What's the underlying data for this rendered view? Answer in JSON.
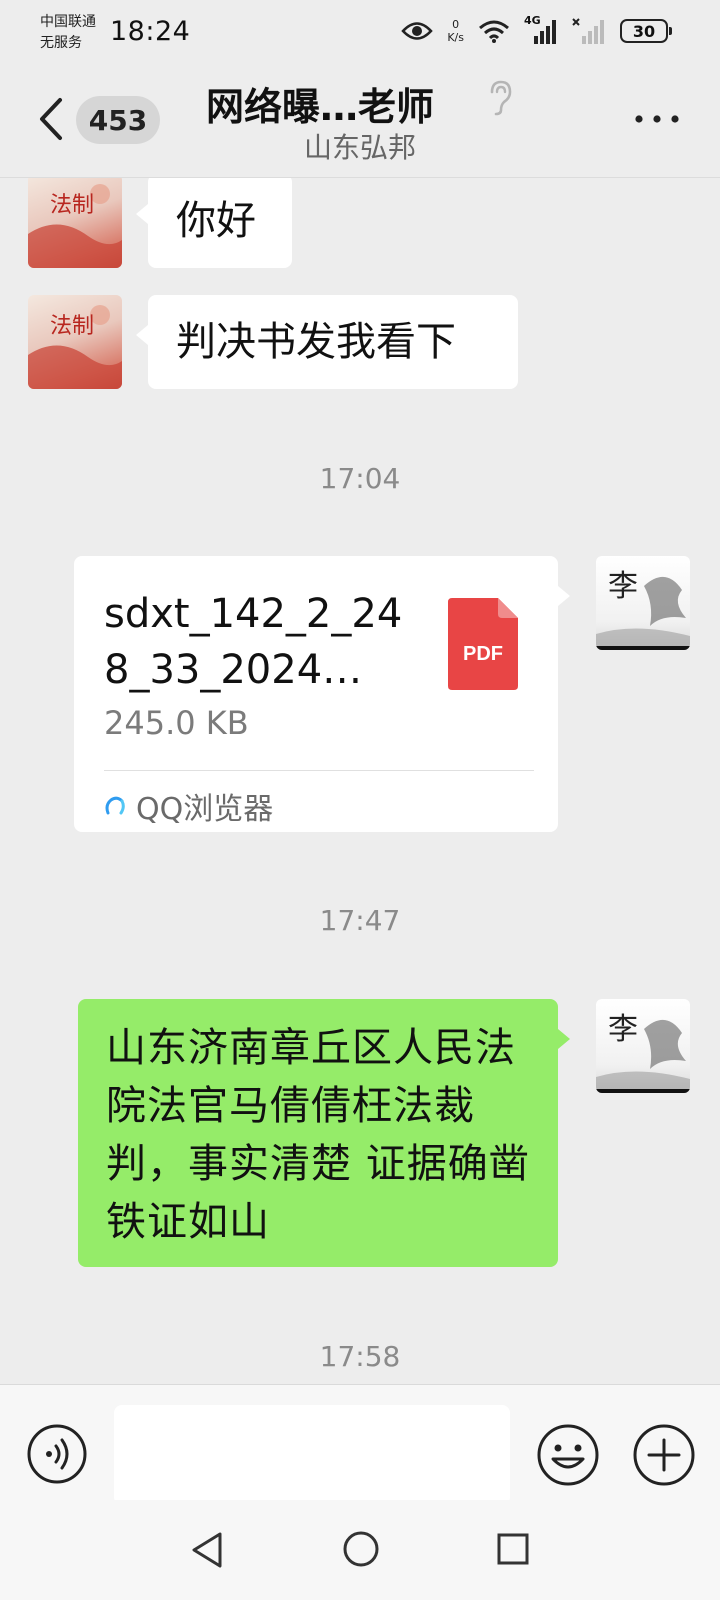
{
  "status_bar": {
    "carrier_line1": "中国联通",
    "carrier_line2": "无服务",
    "time": "18:24",
    "net_speed_value": "0",
    "net_speed_unit": "K/s",
    "network_type": "4G",
    "battery": "30",
    "icons": [
      "eye-icon",
      "wifi-icon",
      "signal-icon",
      "no-signal-icon",
      "battery-icon"
    ]
  },
  "header": {
    "unread_count": "453",
    "title": "网络曝…老师",
    "subtitle": "山东弘邦"
  },
  "messages": [
    {
      "side": "left",
      "type": "text",
      "text": "你好"
    },
    {
      "side": "left",
      "type": "text",
      "text": "判决书发我看下"
    },
    {
      "type": "timestamp",
      "text": "17:04"
    },
    {
      "side": "right",
      "type": "file",
      "file_name": "sdxt_142_2_248_33_2024…",
      "file_size": "245.0 KB",
      "file_type": "PDF",
      "source": "QQ浏览器"
    },
    {
      "type": "timestamp",
      "text": "17:47"
    },
    {
      "side": "right",
      "type": "text",
      "text": "山东济南章丘区人民法院法官马倩倩枉法裁判，事实清楚 证据确凿 铁证如山"
    },
    {
      "type": "timestamp",
      "text": "17:58"
    }
  ],
  "avatars": {
    "left_text": "法制",
    "right_text": "李"
  },
  "colors": {
    "background": "#ededed",
    "sent_bubble": "#95ec69",
    "received_bubble": "#ffffff",
    "pdf_red": "#e84545"
  }
}
